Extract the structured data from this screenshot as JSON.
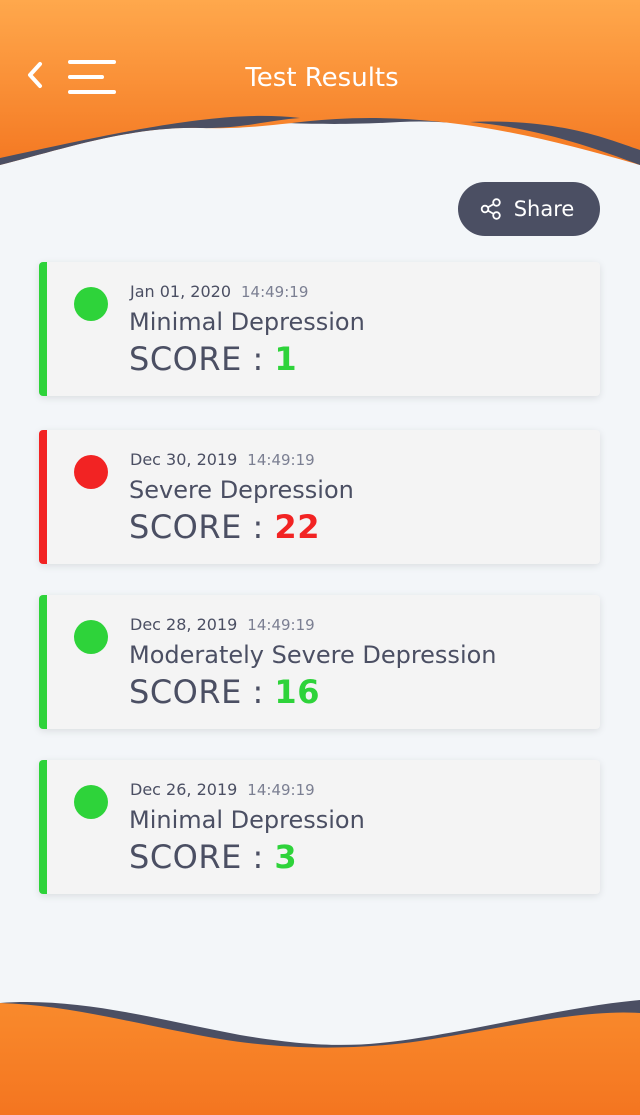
{
  "header": {
    "title": "Test Results",
    "back_icon": "chevron-left-icon",
    "menu_icon": "hamburger-menu-icon"
  },
  "share": {
    "label": "Share",
    "icon": "share-icon"
  },
  "colors": {
    "orange_top": "#ffa24a",
    "orange_bottom": "#f57a22",
    "wave": "#4b4f63",
    "green": "#2ed33a",
    "red": "#f22323",
    "text": "#4b4f63"
  },
  "results": [
    {
      "date": "Jan 01, 2020",
      "time": "14:49:19",
      "level": "Minimal Depression",
      "score_label": "SCORE : ",
      "score": "1",
      "status": "green"
    },
    {
      "date": "Dec 30, 2019",
      "time": "14:49:19",
      "level": "Severe Depression",
      "score_label": "SCORE : ",
      "score": "22",
      "status": "red"
    },
    {
      "date": "Dec 28, 2019",
      "time": "14:49:19",
      "level": "Moderately Severe Depression",
      "score_label": "SCORE : ",
      "score": "16",
      "status": "green"
    },
    {
      "date": "Dec 26, 2019",
      "time": "14:49:19",
      "level": "Minimal Depression",
      "score_label": "SCORE : ",
      "score": "3",
      "status": "green"
    }
  ]
}
